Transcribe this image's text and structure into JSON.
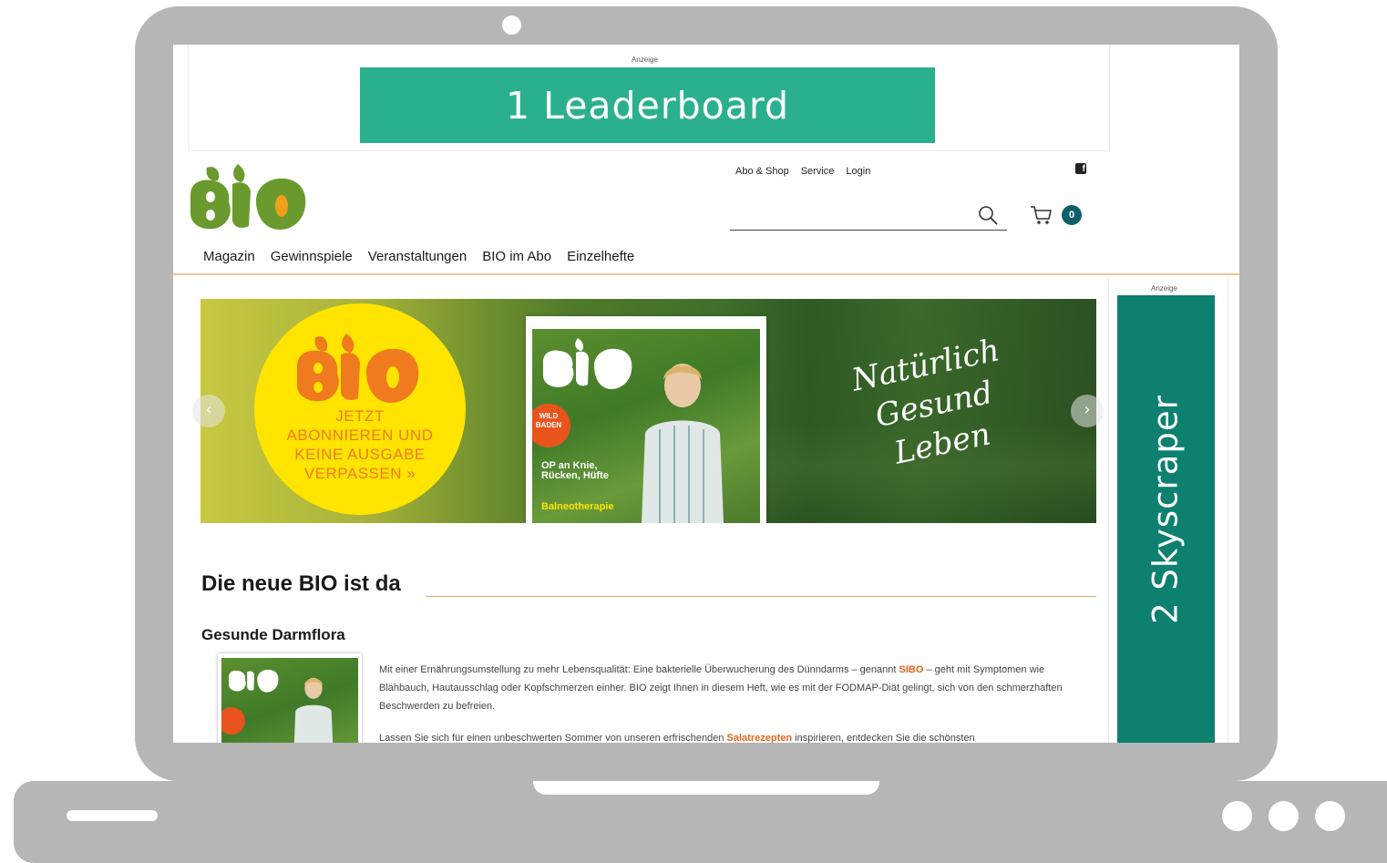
{
  "ads": {
    "label_top": "Anzeige",
    "leaderboard_label": "1 Leaderboard",
    "label_side": "Anzeige",
    "skyscraper_label": "2 Skyscraper"
  },
  "header": {
    "top_nav": [
      "Abo & Shop",
      "Service",
      "Login"
    ],
    "facebook_icon": "f",
    "search_placeholder": "",
    "cart_count": "0"
  },
  "main_nav": [
    "Magazin",
    "Gewinnspiele",
    "Veranstaltungen",
    "BIO im Abo",
    "Einzelhefte"
  ],
  "hero": {
    "circle_text": "JETZT ABONNIEREN UND KEINE AUSGABE VERPASSEN »",
    "circle_lines": [
      "JETZT",
      "ABONNIEREN UND",
      "KEINE AUSGABE",
      "VERPASSEN »"
    ],
    "script_lines": [
      "Natürlich",
      "Gesund",
      "Leben"
    ],
    "mag_badge": [
      "WILD",
      "BADEN"
    ],
    "mag_headlines": [
      "OP an Knie,",
      "Rücken, Hüfte"
    ],
    "mag_headline2": "Balneotherapie",
    "prev_icon": "‹",
    "next_icon": "›"
  },
  "article": {
    "title": "Die neue BIO ist da",
    "subtitle": "Gesunde Darmflora",
    "para1_before": "Mit einer Ernährungsumstellung zu mehr Lebensqualität: Eine bakterielle Überwucherung des Dünndarms – genannt ",
    "para1_link": "SIBO",
    "para1_after": " – geht mit Symptomen wie Blähbauch, Hautausschlag oder Kopfschmerzen einher. BIO zeigt Ihnen in diesem Heft, wie es mit der FODMAP-Diät gelingt, sich von den schmerzhaften Beschwerden zu befreien.",
    "para2_before": "Lassen Sie sich für einen unbeschwerten Sommer von unseren erfrischenden ",
    "para2_link": "Salatrezepten",
    "para2_after": " inspirieren, entdecken Sie die schönsten"
  },
  "colors": {
    "leaderboard": "#2bb08f",
    "skyscraper": "#0d8070",
    "bio_green": "#6a9a2e",
    "accent_orange": "#e8641c",
    "badge": "#0d5f6a"
  }
}
